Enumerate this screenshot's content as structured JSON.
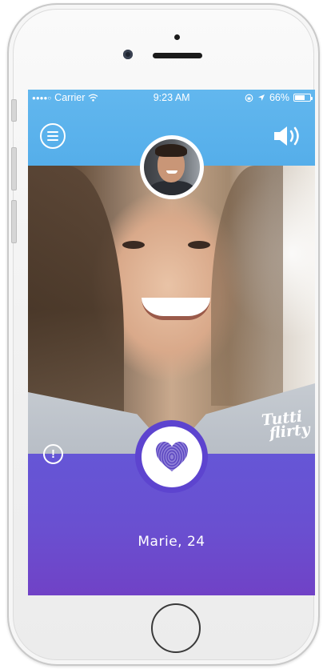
{
  "status_bar": {
    "carrier": "Carrier",
    "time": "9:23 AM",
    "battery_text": "66%",
    "battery_level": 0.66
  },
  "header": {
    "menu_icon": "hamburger-menu-icon",
    "sound_icon": "speaker-volume-icon",
    "color": "#5ab2ec"
  },
  "video": {
    "logo_line1": "Tutti",
    "logo_line2": "flirty"
  },
  "actions": {
    "report_symbol": "!",
    "like_icon": "fingerprint-heart-icon"
  },
  "profile": {
    "name_age": "Marie, 24"
  },
  "colors": {
    "accent_blue": "#5ab2ec",
    "accent_purple": "#6a4fd0",
    "button_purple": "#5d44cf"
  }
}
